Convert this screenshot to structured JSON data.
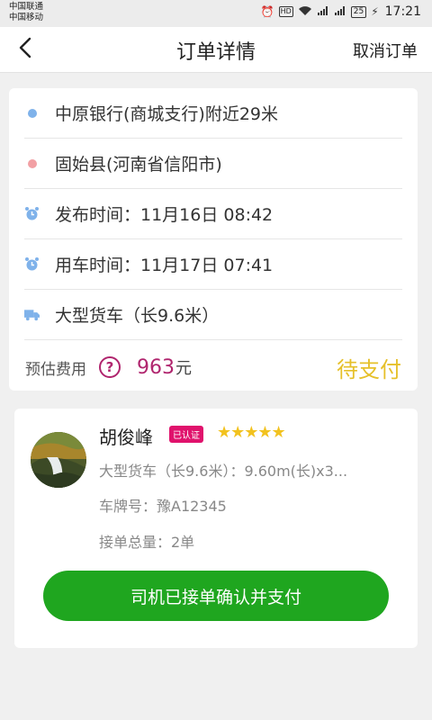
{
  "status_bar": {
    "carrier1": "中国联通",
    "carrier2": "中国移动",
    "hd": "HD",
    "battery": "25",
    "time": "17:21"
  },
  "header": {
    "title": "订单详情",
    "cancel_label": "取消订单"
  },
  "order": {
    "origin": "中原银行(商城支行)附近29米",
    "destination": "固始县(河南省信阳市)",
    "publish_time": "发布时间：11月16日 08:42",
    "use_time": "用车时间：11月17日 07:41",
    "vehicle": "大型货车（长9.6米）",
    "fee_label": "预估费用",
    "fee_value": "963",
    "fee_unit": "元",
    "status": "待支付"
  },
  "driver": {
    "name": "胡俊峰",
    "verified_badge": "已认证",
    "stars": "★★★★★",
    "vehicle_info": "大型货车（长9.6米）：9.60m(长)x3...",
    "plate": "车牌号：豫A12345",
    "total_orders": "接单总量：2单"
  },
  "actions": {
    "confirm_pay": "司机已接单确认并支付"
  },
  "colors": {
    "accent_green": "#1fa61f",
    "price": "#b0256e",
    "status_pending": "#e6c02a",
    "verified_badge": "#e0126c"
  }
}
